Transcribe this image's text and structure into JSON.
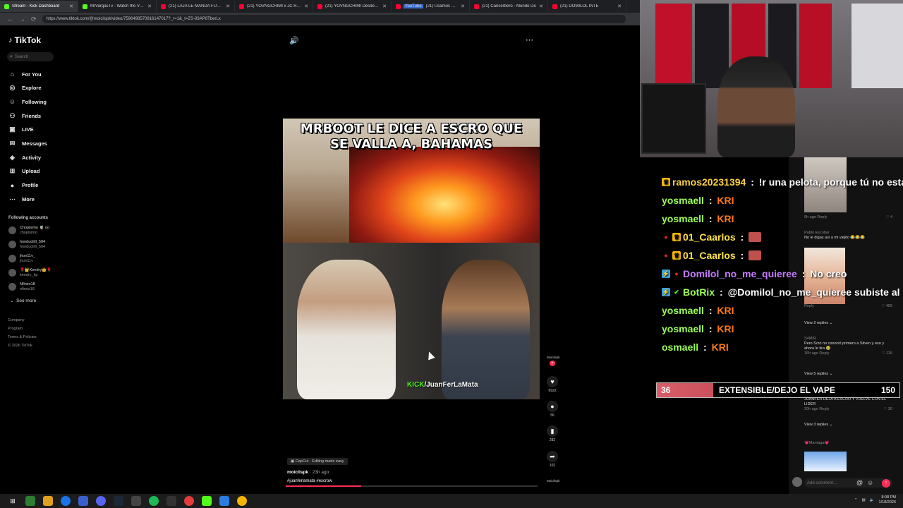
{
  "browser": {
    "tabs": [
      {
        "label": "Stream - Kick Dashboard",
        "color": "#53fc18"
      },
      {
        "label": "MrVargasTv - Watch the VOD",
        "color": "#53fc18"
      },
      {
        "label": "(21) LAJA LE MANDA FUEGO",
        "color": "#ff0033"
      },
      {
        "label": "(21) YOVNGCHIMI x JC REYES",
        "color": "#ff0033"
      },
      {
        "label": "(21) YOVNGCHIMI Desde La",
        "color": "#ff0033"
      },
      {
        "label": "(21) Usamos RANDONAUTICA",
        "color": "#ff0033",
        "badge": "YouTube"
      },
      {
        "label": "(21) Canserbero - Mundo De",
        "color": "#ff0033"
      },
      {
        "label": "(21) DOMILOL INTE",
        "color": "#ff0033"
      }
    ],
    "url": "https://www.tiktok.com/@moiclispk/video/7596498570816147017?_r=1&_t=ZS-93AP8TberLx"
  },
  "sidebar": {
    "logo": "TikTok",
    "search_placeholder": "Search",
    "nav": [
      {
        "label": "For You",
        "icon": "home-icon"
      },
      {
        "label": "Explore",
        "icon": "compass-icon"
      },
      {
        "label": "Following",
        "icon": "following-icon"
      },
      {
        "label": "Friends",
        "icon": "friends-icon"
      },
      {
        "label": "LIVE",
        "icon": "live-icon"
      },
      {
        "label": "Messages",
        "icon": "messages-icon"
      },
      {
        "label": "Activity",
        "icon": "activity-icon"
      },
      {
        "label": "Upload",
        "icon": "upload-icon"
      },
      {
        "label": "Profile",
        "icon": "profile-icon"
      },
      {
        "label": "More",
        "icon": "more-icon"
      }
    ],
    "following_heading": "Following accounts",
    "accounts": [
      {
        "name": "Chopisimo 🧋 oo",
        "handle": "chopisimo"
      },
      {
        "name": "hondudrill_504",
        "handle": "hondudrill_504"
      },
      {
        "name": "jhon11v_",
        "handle": "jhon11v"
      },
      {
        "name": "🌹👑Kendry👑🌹",
        "handle": "kendry_kp"
      },
      {
        "name": "Nfinex18",
        "handle": "nfinex18"
      }
    ],
    "see_more": "See more",
    "footer": [
      "Company",
      "Program",
      "Terms & Policies",
      "© 2026 TikTok"
    ]
  },
  "video": {
    "title_line1": "MRBOOT LE DICE A ESCRO QUE",
    "title_line2": "SE VALLA A, BAHAMAS",
    "kick_prefix": "KICK",
    "kick_channel": "/JuanFerLaMata",
    "capcut": "CapCut · Editing made easy",
    "author": "moiclispk",
    "posted": "· 23h ago",
    "tags": "#juanferlamata #escrow",
    "progress": 0.3,
    "rail": {
      "creator_label": "Moiclispk",
      "likes": "6922",
      "comments": "56",
      "saves": "282",
      "shares": "102",
      "bottom_label": "Moiclispk"
    }
  },
  "chat": [
    {
      "user": "ramos20231394",
      "color": "#ffd23f",
      "badges": [
        "crown"
      ],
      "msg": "!r una pelota, porque tú no estal",
      "kri": false
    },
    {
      "user": "yosmaell",
      "color": "#9cff57",
      "badges": [],
      "msg": "KRI",
      "kri": true
    },
    {
      "user": "yosmaell",
      "color": "#9cff57",
      "badges": [],
      "msg": "KRI",
      "kri": true
    },
    {
      "user": "01_Caarlos",
      "color": "#ffe14d",
      "badges": [
        "dot",
        "crown"
      ],
      "msg": "",
      "kri": false
    },
    {
      "user": "01_Caarlos",
      "color": "#ffe14d",
      "badges": [
        "dot",
        "crown"
      ],
      "msg": "",
      "kri": false
    },
    {
      "user": "Domilol_no_me_quieree",
      "color": "#c77dff",
      "badges": [
        "bot",
        "dot"
      ],
      "msg": "No creo",
      "kri": false
    },
    {
      "user": "BotRix",
      "color": "#9cff57",
      "badges": [
        "bot",
        "check"
      ],
      "msg": "@Domilol_no_me_quieree subiste al nive",
      "kri": false
    },
    {
      "user": "yosmaell",
      "color": "#9cff57",
      "badges": [],
      "msg": "KRI",
      "kri": true
    },
    {
      "user": "yosmaell",
      "color": "#9cff57",
      "badges": [],
      "msg": "KRI",
      "kri": true
    },
    {
      "user": "osmaell",
      "color": "#9cff57",
      "badges": [],
      "msg": "KRI",
      "kri": true
    }
  ],
  "comments": [
    {
      "text": "",
      "meta": "9h ago   Reply",
      "likes": "4"
    },
    {
      "author": "Pablo Escobar",
      "text": "No le digas así a mi viejito 😂😂😂",
      "meta": "",
      "likes": ""
    },
    {
      "text": "",
      "meta": "Reply",
      "likes": "455"
    },
    {
      "text": "View 2 replies ⌄",
      "meta": "",
      "likes": ""
    },
    {
      "author": "S4MIR",
      "text": "Pero Scro no conoció primero a Stiven y eso y ahora le tira 😂",
      "meta": "16h ago   Reply",
      "likes": "116"
    },
    {
      "text": "View 5 replies ⌄",
      "meta": "",
      "likes": ""
    },
    {
      "text": "JUANFER DEJA A ESCRO Y VUELVE CON EL LIDER",
      "meta": "20h ago   Reply",
      "likes": "30"
    },
    {
      "text": "View 3 replies ⌄",
      "meta": "",
      "likes": ""
    },
    {
      "author": "💗Marriaga💗",
      "text": "",
      "meta": "",
      "likes": ""
    }
  ],
  "comment_placeholder": "Add comment...",
  "poll": {
    "left_value": "36",
    "label": "EXTENSIBLE/DEJO EL VAPE",
    "right_value": "150"
  },
  "taskbar": {
    "time": "8:08 PM",
    "date": "1/18/2026"
  }
}
